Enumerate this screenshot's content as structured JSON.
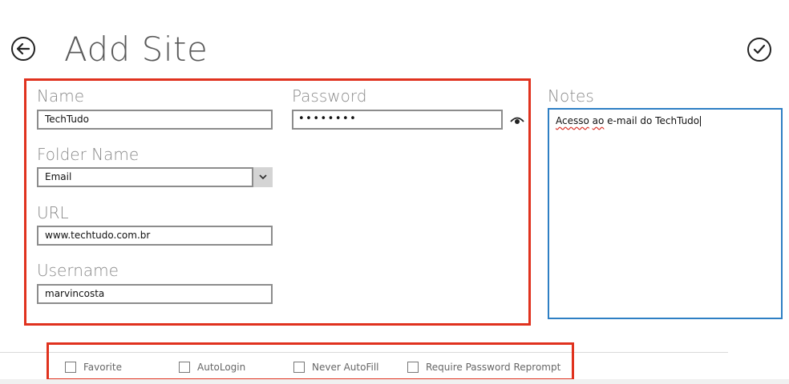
{
  "header": {
    "title": "Add Site",
    "back_icon": "back-arrow-icon",
    "save_icon": "checkmark-icon"
  },
  "form": {
    "name": {
      "label": "Name",
      "value": "TechTudo"
    },
    "password": {
      "label": "Password",
      "value": "••••••••",
      "reveal_icon": "eye-icon"
    },
    "folder": {
      "label": "Folder Name",
      "value": "Email"
    },
    "url": {
      "label": "URL",
      "value": "www.techtudo.com.br"
    },
    "username": {
      "label": "Username",
      "value": "marvincosta"
    }
  },
  "notes": {
    "label": "Notes",
    "text_misspelled_1": "Acesso",
    "text_space": " ",
    "text_misspelled_2": "ao",
    "text_rest": " e-mail do TechTudo"
  },
  "options": [
    {
      "label": "Favorite",
      "checked": false
    },
    {
      "label": "AutoLogin",
      "checked": false
    },
    {
      "label": "Never AutoFill",
      "checked": false
    },
    {
      "label": "Require Password Reprompt",
      "checked": false
    }
  ],
  "colors": {
    "highlight": "#e0321e",
    "notes_border": "#2e7fc4",
    "label_gray": "#8a8a8a"
  }
}
